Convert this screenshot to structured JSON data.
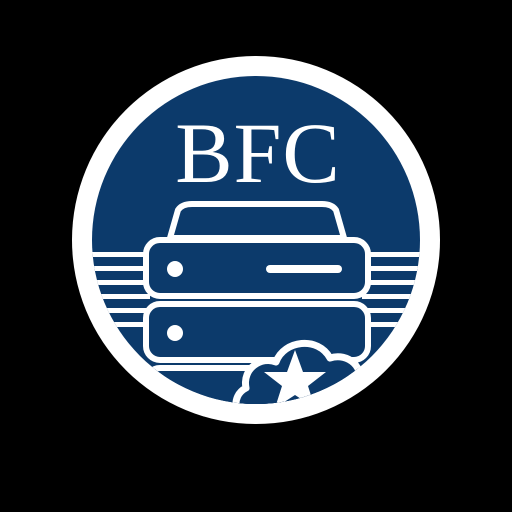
{
  "logo": {
    "text": "BFC",
    "icons": [
      "server-rack-icon",
      "cloud-icon",
      "star-icon"
    ],
    "colors": {
      "background": "#000000",
      "badge_fill": "#0c3a6b",
      "ring": "#ffffff",
      "foreground": "#ffffff"
    }
  }
}
